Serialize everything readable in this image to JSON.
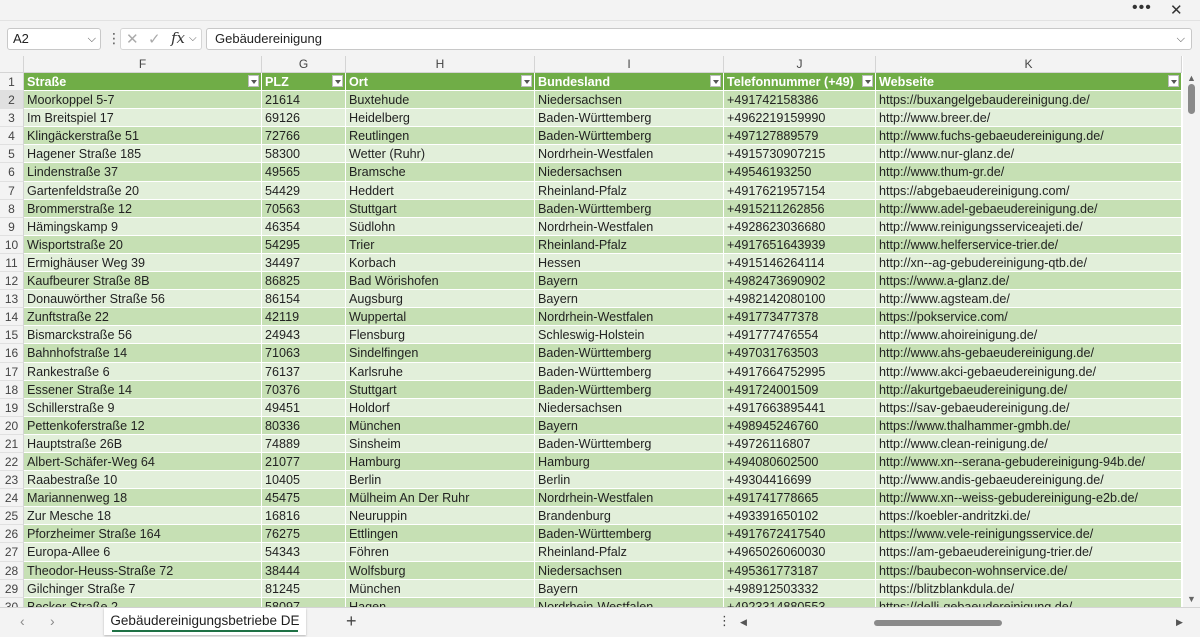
{
  "window": {
    "more_icon": "more-horizontal-icon",
    "close_icon": "close-icon"
  },
  "formula_bar": {
    "name_box": "A2",
    "formula": "Gebäudereinigung"
  },
  "columns": [
    "F",
    "G",
    "H",
    "I",
    "J",
    "K"
  ],
  "header_row": {
    "number": "1",
    "cells": [
      "Straße",
      "PLZ",
      "Ort",
      "Bundesland",
      "Telefonnummer (+49)",
      "Webseite"
    ]
  },
  "rows": [
    {
      "n": "2",
      "c": [
        "Moorkoppel 5-7",
        "21614",
        "Buxtehude",
        "Niedersachsen",
        "+4917421583 86",
        "https://buxangelgebaudereinigung.de/"
      ]
    },
    {
      "n": "3",
      "c": [
        "Im Breitspiel 17",
        "69126",
        "Heidelberg",
        "Baden-Württemberg",
        "+4962219159990",
        "http://www.breer.de/"
      ]
    },
    {
      "n": "4",
      "c": [
        "Klingäckerstraße 51",
        "72766",
        "Reutlingen",
        "Baden-Württemberg",
        "+497127889579",
        "http://www.fuchs-gebaeudereinigung.de/"
      ]
    },
    {
      "n": "5",
      "c": [
        "Hagener Straße 185",
        "58300",
        "Wetter (Ruhr)",
        "Nordrhein-Westfalen",
        "+4915730907215",
        "http://www.nur-glanz.de/"
      ]
    },
    {
      "n": "6",
      "c": [
        "Lindenstraße 37",
        "49565",
        "Bramsche",
        "Niedersachsen",
        "+49546193250",
        "http://www.thum-gr.de/"
      ]
    },
    {
      "n": "7",
      "c": [
        "Gartenfeldstraße 20",
        "54429",
        "Heddert",
        "Rheinland-Pfalz",
        "+4917621957154",
        "https://abgebaeudereinigung.com/"
      ]
    },
    {
      "n": "8",
      "c": [
        "Brommerstraße 12",
        "70563",
        "Stuttgart",
        "Baden-Württemberg",
        "+4915211262856",
        "http://www.adel-gebaeudereinigung.de/"
      ]
    },
    {
      "n": "9",
      "c": [
        "Hämingskamp 9",
        "46354",
        "Südlohn",
        "Nordrhein-Westfalen",
        "+4928623036680",
        "http://www.reinigungsserviceajeti.de/"
      ]
    },
    {
      "n": "10",
      "c": [
        "Wisportstraße 20",
        "54295",
        "Trier",
        "Rheinland-Pfalz",
        "+4917651643939",
        "http://www.helferservice-trier.de/"
      ]
    },
    {
      "n": "11",
      "c": [
        "Ermighäuser Weg 39",
        "34497",
        "Korbach",
        "Hessen",
        "+4915146264114",
        "http://xn--ag-gebudereinigung-qtb.de/"
      ]
    },
    {
      "n": "12",
      "c": [
        "Kaufbeurer Straße 8B",
        "86825",
        "Bad Wörishofen",
        "Bayern",
        "+4982473690902",
        "https://www.a-glanz.de/"
      ]
    },
    {
      "n": "13",
      "c": [
        "Donauwörther Straße 56",
        "86154",
        "Augsburg",
        "Bayern",
        "+4982142080100",
        "http://www.agsteam.de/"
      ]
    },
    {
      "n": "14",
      "c": [
        "Zunftstraße 22",
        "42119",
        "Wuppertal",
        "Nordrhein-Westfalen",
        "+491773477378",
        "https://pokservice.com/"
      ]
    },
    {
      "n": "15",
      "c": [
        "Bismarckstraße 56",
        "24943",
        "Flensburg",
        "Schleswig-Holstein",
        "+491777476554",
        "http://www.ahoireinigung.de/"
      ]
    },
    {
      "n": "16",
      "c": [
        "Bahnhofstraße 14",
        "71063",
        "Sindelfingen",
        "Baden-Württemberg",
        "+497031763503",
        "http://www.ahs-gebaeudereinigung.de/"
      ]
    },
    {
      "n": "17",
      "c": [
        "Rankestraße 6",
        "76137",
        "Karlsruhe",
        "Baden-Württemberg",
        "+4917664752995",
        "http://www.akci-gebaeudereinigung.de/"
      ]
    },
    {
      "n": "18",
      "c": [
        "Essener Straße 14",
        "70376",
        "Stuttgart",
        "Baden-Württemberg",
        "+491724001509",
        "http://akurtgebaeudereinigung.de/"
      ]
    },
    {
      "n": "19",
      "c": [
        "Schillerstraße 9",
        "49451",
        "Holdorf",
        "Niedersachsen",
        "+4917663895441",
        "https://sav-gebaeudereinigung.de/"
      ]
    },
    {
      "n": "20",
      "c": [
        "Pettenkoferstraße 12",
        "80336",
        "München",
        "Bayern",
        "+498945246760",
        "https://www.thalhammer-gmbh.de/"
      ]
    },
    {
      "n": "21",
      "c": [
        "Hauptstraße 26B",
        "74889",
        "Sinsheim",
        "Baden-Württemberg",
        "+49726116807",
        "http://www.clean-reinigung.de/"
      ]
    },
    {
      "n": "22",
      "c": [
        "Albert-Schäfer-Weg 64",
        "21077",
        "Hamburg",
        "Hamburg",
        "+494080602500",
        "http://www.xn--serana-gebudereinigung-94b.de/"
      ]
    },
    {
      "n": "23",
      "c": [
        "Raabestraße 10",
        "10405",
        "Berlin",
        "Berlin",
        "+49304416699",
        "http://www.andis-gebaeudereinigung.de/"
      ]
    },
    {
      "n": "24",
      "c": [
        "Mariannenweg 18",
        "45475",
        "Mülheim An Der Ruhr",
        "Nordrhein-Westfalen",
        "+491741778665",
        "http://www.xn--weiss-gebudereinigung-e2b.de/"
      ]
    },
    {
      "n": "25",
      "c": [
        "Zur Mesche 18",
        "16816",
        "Neuruppin",
        "Brandenburg",
        "+493391650102",
        "https://koebler-andritzki.de/"
      ]
    },
    {
      "n": "26",
      "c": [
        "Pforzheimer Straße 164",
        "76275",
        "Ettlingen",
        "Baden-Württemberg",
        "+4917672417540",
        "https://www.vele-reinigungsservice.de/"
      ]
    },
    {
      "n": "27",
      "c": [
        "Europa-Allee 6",
        "54343",
        "Föhren",
        "Rheinland-Pfalz",
        "+4965026060030",
        "https://am-gebaeudereinigung-trier.de/"
      ]
    },
    {
      "n": "28",
      "c": [
        "Theodor-Heuss-Straße 72",
        "38444",
        "Wolfsburg",
        "Niedersachsen",
        "+495361773187",
        "https://baubecon-wohnservice.de/"
      ]
    },
    {
      "n": "29",
      "c": [
        "Gilchinger Straße 7",
        "81245",
        "München",
        "Bayern",
        "+498912503332",
        "https://blitzblankdula.de/"
      ]
    },
    {
      "n": "30",
      "c": [
        "Becker Straße 2",
        "58097",
        "Hagen",
        "Nordrhein-Westfalen",
        "+4923314880553",
        "https://delli-gebaeudereinigung.de/"
      ]
    }
  ],
  "sheet_tab": "Gebäudereinigungsbetriebe DE",
  "colors": {
    "header_green": "#70ad47",
    "band_dark": "#c6e0b4",
    "band_light": "#e2efda",
    "accent": "#1e7145"
  }
}
